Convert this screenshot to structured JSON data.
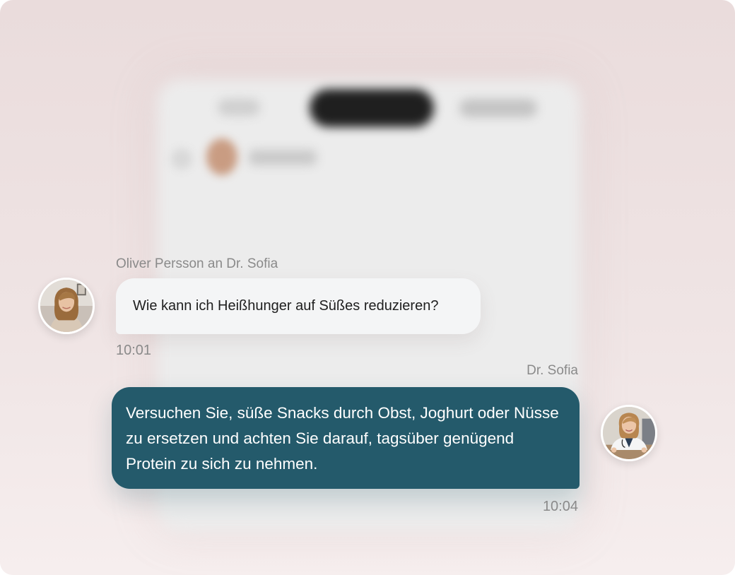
{
  "conversation": {
    "incoming": {
      "sender_label": "Oliver Persson an Dr. Sofia",
      "text": "Wie kann ich Heißhunger auf Süßes reduzieren?",
      "time": "10:01",
      "avatar_icon": "woman-avatar"
    },
    "outgoing": {
      "sender_label": "Dr. Sofia",
      "text": "Versuchen Sie, süße Snacks durch Obst, Joghurt oder Nüsse zu ersetzen und achten Sie darauf, tagsüber genügend Protein zu sich zu nehmen.",
      "time": "10:04",
      "avatar_icon": "doctor-avatar"
    }
  },
  "colors": {
    "outgoing_bubble": "#245a6b",
    "incoming_bubble": "#f4f5f6",
    "background": "#eadcdc",
    "meta_text": "#8a8a8a"
  }
}
